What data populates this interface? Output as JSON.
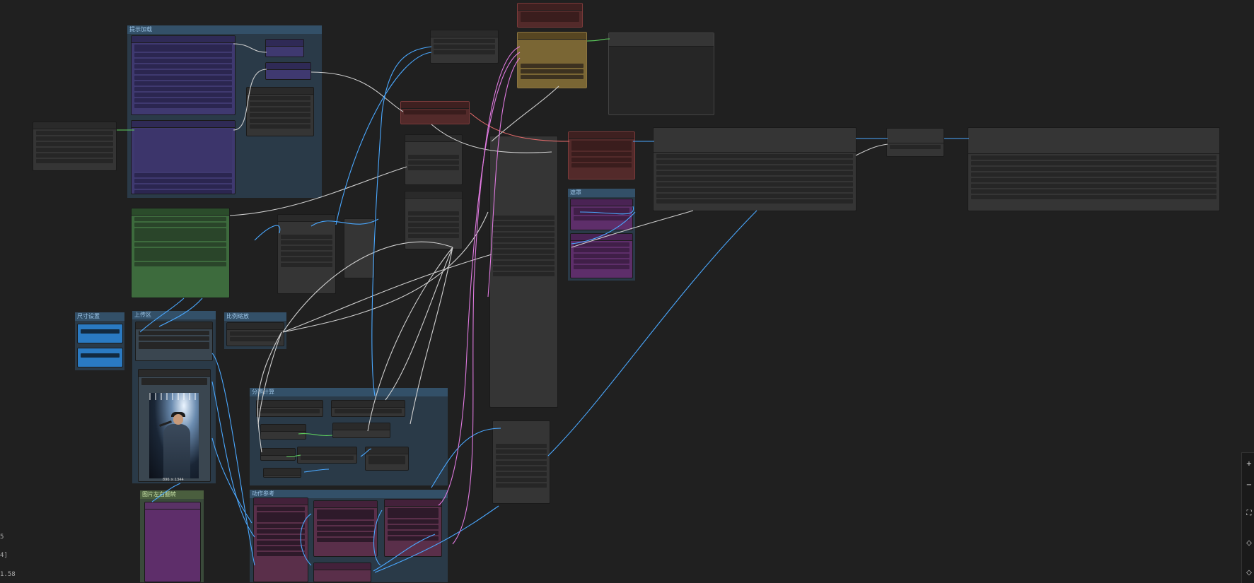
{
  "app": {
    "name": "ComfyUI node graph"
  },
  "groups": [
    {
      "key": "prompt",
      "title": "提示加载"
    },
    {
      "key": "size",
      "title": "尺寸设置"
    },
    {
      "key": "upload",
      "title": "上传区"
    },
    {
      "key": "scale",
      "title": "比例缩放"
    },
    {
      "key": "resolution",
      "title": "分辨计算"
    },
    {
      "key": "flip",
      "title": "图片左右翻转"
    },
    {
      "key": "action",
      "title": "动作参考"
    },
    {
      "key": "mask",
      "title": "遮罩"
    }
  ],
  "image_caption": "896 × 1344",
  "bottom_info": [
    "5",
    "4]",
    "1.58"
  ],
  "sidebar": [
    "+",
    "−",
    "⛶",
    "◇",
    "◇"
  ],
  "colors": {
    "background": "#202020",
    "group": "#2a3a48",
    "link_blue": "#4aa8ff",
    "link_pink": "#e07ae0",
    "link_white": "#cfcfcf",
    "link_red": "#e06a6a"
  }
}
